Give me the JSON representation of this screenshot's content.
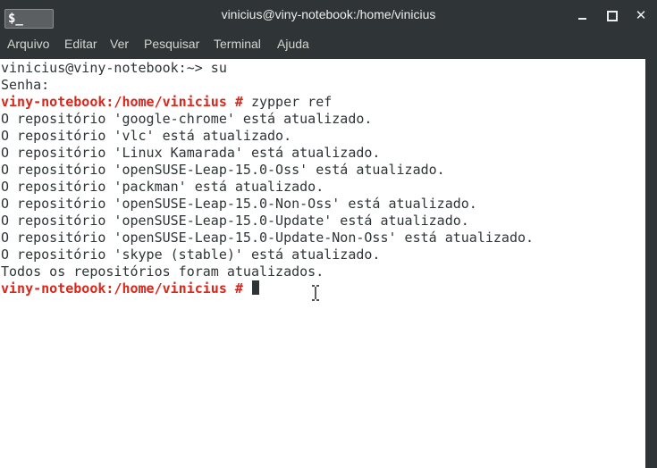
{
  "window": {
    "title": "vinicius@viny-notebook:/home/vinicius",
    "app_icon": "$_"
  },
  "menu": {
    "items": [
      "Arquivo",
      "Editar",
      "Ver",
      "Pesquisar",
      "Terminal",
      "Ajuda"
    ]
  },
  "terminal": {
    "lines": [
      {
        "prompt": "",
        "text": "vinicius@viny-notebook:~> su"
      },
      {
        "prompt": "",
        "text": "Senha:"
      },
      {
        "prompt": "viny-notebook:/home/vinicius #",
        "text": " zypper ref"
      },
      {
        "prompt": "",
        "text": "O repositório 'google-chrome' está atualizado."
      },
      {
        "prompt": "",
        "text": "O repositório 'vlc' está atualizado."
      },
      {
        "prompt": "",
        "text": "O repositório 'Linux Kamarada' está atualizado."
      },
      {
        "prompt": "",
        "text": "O repositório 'openSUSE-Leap-15.0-Oss' está atualizado."
      },
      {
        "prompt": "",
        "text": "O repositório 'packman' está atualizado."
      },
      {
        "prompt": "",
        "text": "O repositório 'openSUSE-Leap-15.0-Non-Oss' está atualizado."
      },
      {
        "prompt": "",
        "text": "O repositório 'openSUSE-Leap-15.0-Update' está atualizado."
      },
      {
        "prompt": "",
        "text": "O repositório 'openSUSE-Leap-15.0-Update-Non-Oss' está atualizado."
      },
      {
        "prompt": "",
        "text": "O repositório 'skype (stable)' está atualizado."
      },
      {
        "prompt": "",
        "text": "Todos os repositórios foram atualizados."
      },
      {
        "prompt": "viny-notebook:/home/vinicius #",
        "text": " "
      }
    ]
  },
  "colors": {
    "titlebar_bg": "#2f3437",
    "prompt": "#d9271c",
    "terminal_fg": "#2e3436",
    "terminal_bg": "#ffffff"
  },
  "icons": {
    "minimize": "minimize-icon",
    "maximize": "maximize-icon",
    "close": "close-icon",
    "cursor": "text-cursor-icon"
  }
}
